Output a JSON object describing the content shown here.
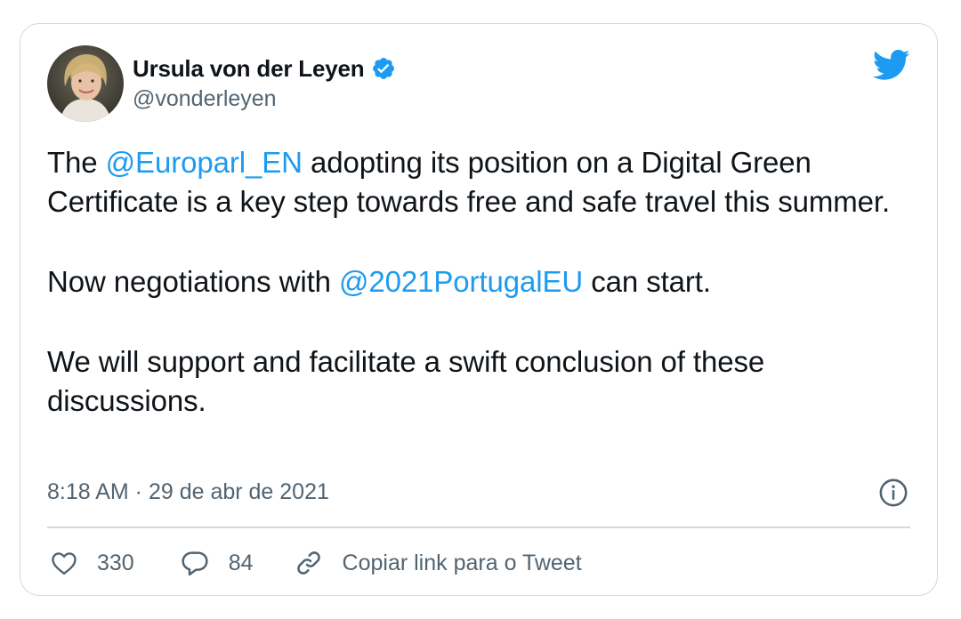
{
  "author": {
    "name": "Ursula von der Leyen",
    "handle": "@vonderleyen",
    "verified": true
  },
  "tweet": {
    "p1_before": "The ",
    "p1_mention": "@Europarl_EN",
    "p1_after": " adopting its position on a Digital Green Certificate is a key step towards free and safe travel this summer.",
    "p2_before": "Now negotiations with ",
    "p2_mention": "@2021PortugalEU",
    "p2_after": " can start.",
    "p3": "We will support and facilitate a swift conclusion of these discussions.",
    "timestamp": "8:18 AM · 29 de abr de 2021"
  },
  "actions": {
    "likes": "330",
    "replies": "84",
    "copy_link_label": "Copiar link para o Tweet"
  },
  "icons": {
    "brand": "twitter-bird-icon",
    "verified": "verified-badge-icon",
    "info": "info-icon",
    "like": "heart-icon",
    "reply": "reply-icon",
    "link": "link-icon"
  },
  "colors": {
    "accent": "#1d9bf0",
    "text": "#0f1419",
    "secondary": "#536471",
    "border": "#cfd9de"
  }
}
